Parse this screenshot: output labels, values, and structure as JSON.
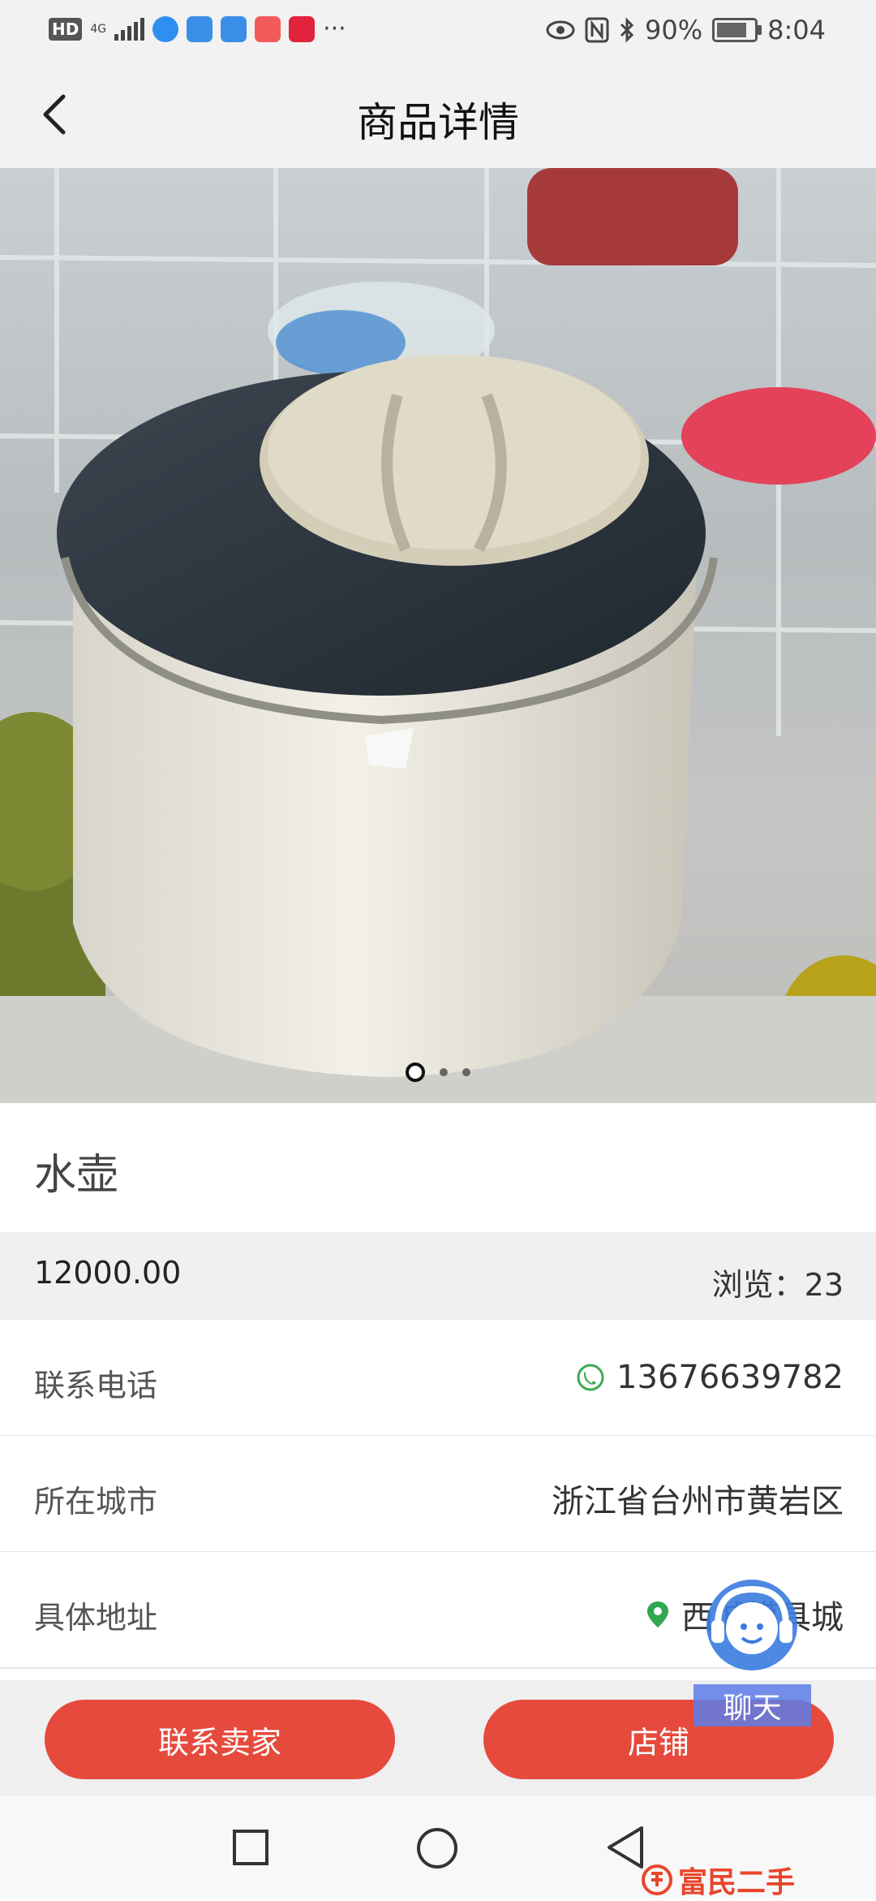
{
  "status_bar": {
    "hd": "HD",
    "network": "4G",
    "battery_percent": "90%",
    "time": "8:04",
    "more": "···"
  },
  "header": {
    "title": "商品详情"
  },
  "gallery": {
    "image_count": 3,
    "active_index": 0
  },
  "product": {
    "name": "水壶",
    "price": "12000.00",
    "views": "浏览：23"
  },
  "details": [
    {
      "label": "联系电话",
      "value": "13676639782",
      "icon": "phone-icon"
    },
    {
      "label": "所在城市",
      "value": "浙江省台州市黄岩区"
    },
    {
      "label": "具体地址",
      "value": "西城模具城",
      "icon": "location-pin-icon"
    }
  ],
  "actions": {
    "contact_seller": "联系卖家",
    "shop": "店铺"
  },
  "chat": {
    "label": "聊天"
  },
  "watermark": {
    "text": "富民二手"
  },
  "colors": {
    "accent": "#e64a3d",
    "phone_icon": "#3bab4f",
    "pin_icon": "#2fa84f",
    "chat_bg": "#5c7de6"
  }
}
